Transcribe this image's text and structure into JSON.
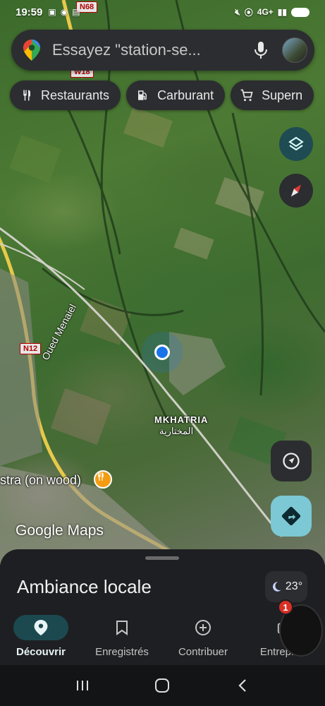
{
  "status_bar": {
    "time": "19:59",
    "network": "4G+",
    "road_shield_top": "N68"
  },
  "search": {
    "placeholder": "Essayez \"station-se...",
    "icons": [
      "google-maps-pin-icon",
      "mic-icon",
      "avatar"
    ]
  },
  "chips": [
    {
      "label": "Restaurants",
      "icon": "restaurant-icon"
    },
    {
      "label": "Carburant",
      "icon": "fuel-icon"
    },
    {
      "label": "Supern",
      "icon": "cart-icon"
    }
  ],
  "map": {
    "road_shields": [
      "W18",
      "N12"
    ],
    "place_name_fr": "MKHATRIA",
    "place_name_ar": "المختارية",
    "river": "Oued Menaiel",
    "poi": "stra (on wood)",
    "attribution": "Google Maps"
  },
  "sheet": {
    "title": "Ambiance locale",
    "weather": "23°"
  },
  "nav": {
    "items": [
      {
        "label": "Découvrir",
        "active": true
      },
      {
        "label": "Enregistrés"
      },
      {
        "label": "Contribuer"
      },
      {
        "label": "Entreprise"
      }
    ],
    "badge": "1"
  },
  "colors": {
    "accent": "#7cc8d4",
    "sheet_bg": "#1e1f22",
    "chip_bg": "#2b2d30",
    "location_blue": "#1a73e8"
  }
}
